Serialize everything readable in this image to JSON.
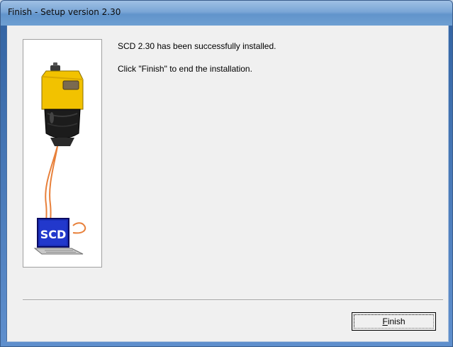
{
  "window": {
    "title": "Finish - Setup version 2.30"
  },
  "graphic": {
    "icon": "scanner-connected-to-laptop",
    "screen_label": "SCD",
    "colors": {
      "scanner_body": "#f2c200",
      "cable": "#e8803a",
      "screen": "#1a2fb8"
    }
  },
  "messages": {
    "line1": "SCD 2.30 has been successfully installed.",
    "line2": "Click \"Finish\" to end the installation."
  },
  "buttons": {
    "finish_accel": "F",
    "finish_rest": "inish"
  }
}
